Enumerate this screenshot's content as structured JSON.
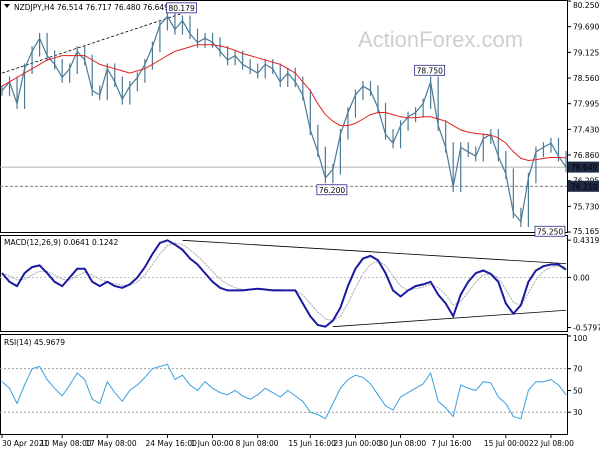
{
  "header": {
    "main": "NZDJPY,H4  76.514 76.717 76.480 76.649",
    "macd": "MACD(12,26,9) 0.0641 0.1242",
    "rsi": "RSI(14) 45.9679"
  },
  "watermark": "ActionForex.com",
  "colors": {
    "price": "#4b7a96",
    "ma": "#e02020",
    "macd_line": "#1a1aa0",
    "macd_signal": "#a8a8a8",
    "rsi": "#3aa0e0",
    "trend": "#000000",
    "hline": "#808080",
    "label_bg": "#1f2a44"
  },
  "chart_data": [
    {
      "type": "line",
      "panel": "price",
      "ylim": [
        75.165,
        80.45
      ],
      "y_ticks": [
        "80.250",
        "79.690",
        "79.125",
        "78.560",
        "77.995",
        "77.430",
        "76.860",
        "76.295",
        "75.730",
        "75.165"
      ],
      "current_price_label": "76.649",
      "level_label": "76.210",
      "level_value": 76.21,
      "annotations": [
        {
          "text": "80.179",
          "x": 24,
          "y": 80.179
        },
        {
          "text": "78.750",
          "x": 57,
          "y": 78.75
        },
        {
          "text": "76.200",
          "x": 44,
          "y": 76.2
        },
        {
          "text": "75.250",
          "x": 73,
          "y": 75.25
        }
      ],
      "trend_line": {
        "x": [
          0,
          24
        ],
        "y": [
          78.8,
          80.17
        ]
      },
      "x_labels": [
        "30 Apr 2021",
        "10 May 08:00",
        "17 May 08:00",
        "24 May 16:00",
        "1 Jun 00:00",
        "8 Jun 08:00",
        "15 Jun 16:00",
        "23 Jun 00:00",
        "30 Jun 08:00",
        "7 Jul 16:00",
        "15 Jul 00:00",
        "22 Jul 08:00"
      ],
      "x_label_index": [
        0,
        8,
        14,
        22,
        28,
        34,
        41,
        47,
        53,
        60,
        67,
        73
      ],
      "price": [
        78.4,
        78.6,
        78.1,
        78.9,
        79.3,
        79.6,
        79.2,
        79.0,
        78.7,
        78.9,
        79.3,
        79.1,
        78.4,
        78.3,
        78.9,
        78.6,
        78.2,
        78.5,
        78.7,
        79.0,
        79.4,
        79.9,
        80.1,
        79.8,
        80.0,
        79.7,
        79.5,
        79.6,
        79.5,
        79.3,
        79.1,
        79.2,
        79.0,
        78.9,
        78.8,
        79.0,
        78.9,
        78.6,
        78.8,
        78.6,
        78.3,
        77.5,
        77.0,
        76.4,
        76.6,
        77.4,
        77.9,
        78.3,
        78.5,
        78.4,
        78.0,
        77.4,
        77.2,
        77.6,
        77.8,
        77.9,
        78.1,
        78.6,
        77.6,
        77.1,
        76.2,
        77.1,
        77.0,
        76.9,
        77.3,
        77.4,
        76.9,
        76.5,
        75.6,
        75.4,
        76.4,
        77.0,
        77.1,
        77.2,
        76.9,
        76.65
      ],
      "ma": [
        78.5,
        78.6,
        78.7,
        78.8,
        78.9,
        79.0,
        79.1,
        79.15,
        79.2,
        79.2,
        79.2,
        79.2,
        79.1,
        79.0,
        78.95,
        78.9,
        78.85,
        78.8,
        78.85,
        78.9,
        79.0,
        79.1,
        79.2,
        79.3,
        79.35,
        79.4,
        79.45,
        79.45,
        79.45,
        79.42,
        79.38,
        79.32,
        79.25,
        79.2,
        79.15,
        79.1,
        79.05,
        79.0,
        78.9,
        78.8,
        78.6,
        78.4,
        78.1,
        77.85,
        77.7,
        77.6,
        77.6,
        77.65,
        77.75,
        77.85,
        77.9,
        77.9,
        77.85,
        77.8,
        77.78,
        77.78,
        77.8,
        77.8,
        77.75,
        77.7,
        77.6,
        77.5,
        77.45,
        77.42,
        77.4,
        77.38,
        77.32,
        77.2,
        77.0,
        76.85,
        76.8,
        76.82,
        76.85,
        76.87,
        76.87,
        76.86
      ]
    },
    {
      "type": "line",
      "panel": "macd",
      "ylim": [
        -0.62,
        0.48
      ],
      "y_ticks": [
        "0.4319",
        "0.00",
        "-0.5797"
      ],
      "trend_lines": [
        {
          "x": [
            24,
            75
          ],
          "y": [
            0.43,
            0.16
          ]
        },
        {
          "x": [
            44,
            75
          ],
          "y": [
            -0.57,
            -0.38
          ]
        }
      ],
      "macd": [
        0.05,
        -0.05,
        -0.1,
        0.05,
        0.12,
        0.14,
        0.05,
        -0.05,
        -0.1,
        0.0,
        0.1,
        0.1,
        -0.05,
        -0.1,
        -0.05,
        -0.1,
        -0.12,
        -0.08,
        0.0,
        0.12,
        0.27,
        0.4,
        0.43,
        0.38,
        0.32,
        0.22,
        0.15,
        0.05,
        -0.05,
        -0.12,
        -0.15,
        -0.15,
        -0.15,
        -0.14,
        -0.13,
        -0.14,
        -0.15,
        -0.15,
        -0.15,
        -0.15,
        -0.3,
        -0.45,
        -0.55,
        -0.57,
        -0.5,
        -0.35,
        -0.1,
        0.1,
        0.22,
        0.25,
        0.2,
        0.05,
        -0.15,
        -0.22,
        -0.15,
        -0.1,
        -0.08,
        -0.05,
        -0.2,
        -0.3,
        -0.45,
        -0.2,
        -0.05,
        0.05,
        0.08,
        0.04,
        -0.05,
        -0.3,
        -0.42,
        -0.32,
        -0.05,
        0.08,
        0.13,
        0.15,
        0.15,
        0.09
      ],
      "signal": [
        0.05,
        0.02,
        -0.03,
        -0.02,
        0.03,
        0.07,
        0.07,
        0.03,
        -0.02,
        -0.03,
        0.02,
        0.06,
        0.03,
        -0.02,
        -0.05,
        -0.07,
        -0.09,
        -0.09,
        -0.05,
        0.03,
        0.15,
        0.27,
        0.37,
        0.4,
        0.38,
        0.32,
        0.25,
        0.16,
        0.07,
        -0.02,
        -0.08,
        -0.12,
        -0.14,
        -0.14,
        -0.14,
        -0.14,
        -0.14,
        -0.14,
        -0.15,
        -0.15,
        -0.2,
        -0.3,
        -0.4,
        -0.48,
        -0.5,
        -0.45,
        -0.3,
        -0.12,
        0.04,
        0.15,
        0.19,
        0.14,
        0.02,
        -0.1,
        -0.15,
        -0.13,
        -0.11,
        -0.08,
        -0.12,
        -0.2,
        -0.32,
        -0.28,
        -0.17,
        -0.05,
        0.03,
        0.04,
        0.0,
        -0.14,
        -0.29,
        -0.32,
        -0.18,
        -0.03,
        0.07,
        0.12,
        0.13,
        0.12
      ]
    },
    {
      "type": "line",
      "panel": "rsi",
      "ylim": [
        0,
        100
      ],
      "y_ticks": [
        "100",
        "70",
        "50",
        "30"
      ],
      "levels": [
        70,
        30
      ],
      "values": [
        58,
        52,
        38,
        55,
        70,
        72,
        60,
        52,
        45,
        55,
        66,
        60,
        42,
        38,
        58,
        48,
        40,
        50,
        55,
        62,
        70,
        72,
        74,
        60,
        64,
        55,
        50,
        58,
        52,
        48,
        46,
        50,
        45,
        42,
        46,
        52,
        48,
        44,
        50,
        45,
        40,
        30,
        28,
        24,
        38,
        52,
        60,
        64,
        62,
        56,
        46,
        36,
        32,
        44,
        48,
        52,
        56,
        66,
        40,
        34,
        26,
        55,
        52,
        50,
        58,
        57,
        44,
        38,
        26,
        24,
        50,
        58,
        58,
        60,
        55,
        45.97
      ]
    }
  ]
}
